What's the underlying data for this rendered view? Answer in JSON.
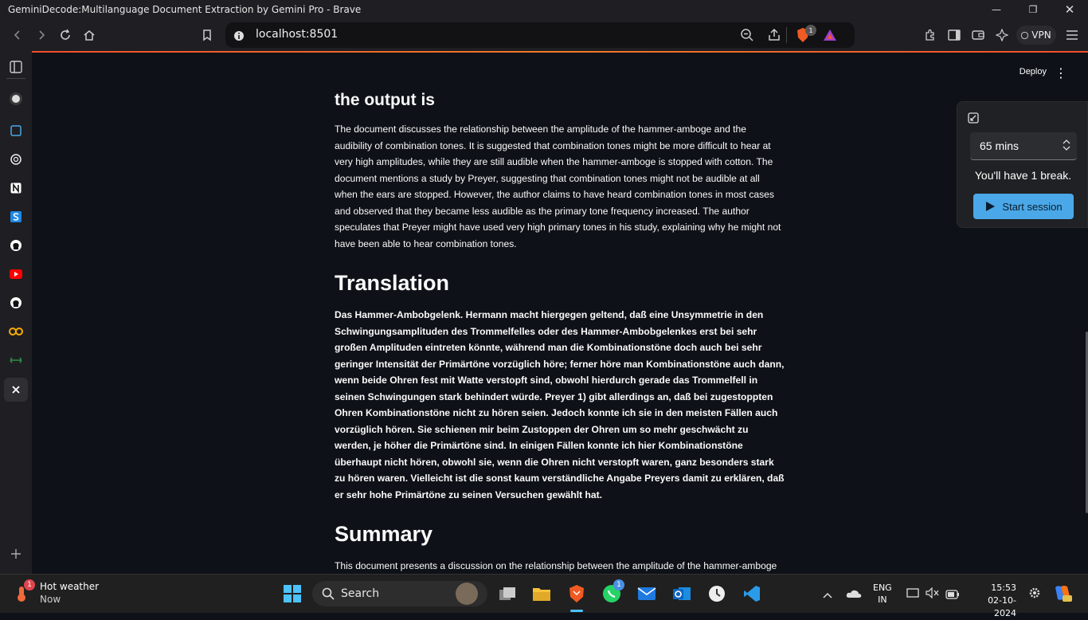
{
  "window": {
    "title": "GeminiDecode:Multilanguage Document Extraction by Gemini Pro - Brave"
  },
  "browser": {
    "url": "localhost:8501",
    "brave_badge": "1",
    "vpn_label": "VPN"
  },
  "app": {
    "deploy_label": "Deploy",
    "sections": {
      "output_heading": "the output is",
      "output_text": "The document discusses the relationship between the amplitude of the hammer-amboge and the audibility of combination tones. It is suggested that combination tones might be more difficult to hear at very high amplitudes, while they are still audible when the hammer-amboge is stopped with cotton. The document mentions a study by Preyer, suggesting that combination tones might not be audible at all when the ears are stopped. However, the author claims to have heard combination tones in most cases and observed that they became less audible as the primary tone frequency increased. The author speculates that Preyer might have used very high primary tones in his study, explaining why he might not have been able to hear combination tones.",
      "translation_heading": "Translation",
      "translation_text": "Das Hammer-Ambobgelenk. Hermann macht hiergegen geltend, daß eine Unsymmetrie in den Schwingungsamplituden des Trommelfelles oder des Hammer-Ambobgelenkes erst bei sehr großen Amplituden eintreten könnte, während man die Kombinationstöne doch auch bei sehr geringer Intensität der Primärtöne vorzüglich höre; ferner höre man Kombinationstöne auch dann, wenn beide Ohren fest mit Watte verstopft sind, obwohl hierdurch gerade das Trommelfell in seinen Schwingungen stark behindert würde. Preyer 1) gibt allerdings an, daß bei zugestoppten Ohren Kombinationstöne nicht zu hören seien. Jedoch konnte ich sie in den meisten Fällen auch vorzüglich hören. Sie schienen mir beim Zustoppen der Ohren um so mehr geschwächt zu werden, je höher die Primärtöne sind. In einigen Fällen konnte ich hier Kombinationstöne überhaupt nicht hören, obwohl sie, wenn die Ohren nicht verstopft waren, ganz besonders stark zu hören waren. Vielleicht ist die sonst kaum verständliche Angabe Preyers damit zu erklären, daß er sehr hohe Primärtöne zu seinen Versuchen gewählt hat.",
      "summary_heading": "Summary",
      "summary_text": "This document presents a discussion on the relationship between the amplitude of the hammer-amboge and the audibility of combination tones. The author challenges previous studies by Preyer, claiming to"
    }
  },
  "timer_popup": {
    "duration": "65 mins",
    "break_text": "You'll have 1 break.",
    "start_label": "Start session"
  },
  "taskbar": {
    "weather_title": "Hot weather",
    "weather_sub": "Now",
    "weather_badge": "1",
    "search_label": "Search",
    "whatsapp_badge": "1",
    "lang_line1": "ENG",
    "lang_line2": "IN",
    "time": "15:53",
    "date": "02-10-2024"
  }
}
